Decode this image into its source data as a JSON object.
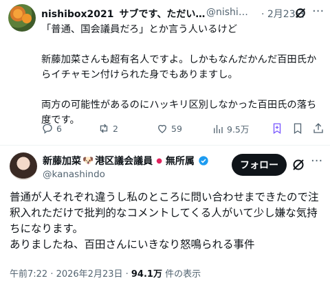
{
  "reply": {
    "display_name": "nishibox2021",
    "subtitle": "サブです、ただい…",
    "handle": "@nishi…",
    "date": "· 2月23日",
    "paragraphs": [
      "「普通、国会議員だろ」とか言う人いるけど",
      "新藤加菜さんも超有名人ですよ。しかもなんだかんだ百田氏からイチャモン付けられた身でもありますし。",
      "両方の可能性があるのにハッキリ区別しなかった百田氏の落ち度です。"
    ],
    "actions": {
      "replies": "6",
      "reposts": "2",
      "likes": "59",
      "views": "9.5万"
    }
  },
  "main_post": {
    "display_name": "新藤加菜",
    "name_suffix": "港区議会議員",
    "party": "無所属",
    "handle": "@kanashindo",
    "follow_label": "フォロー",
    "lines": [
      "普通が人それぞれ違うし私のところに問い合わせまできたので注釈入れただけで批判的なコメントしてくる人がいて少し嫌な気持ちになります。",
      "ありましたね、百田さんにいきなり怒鳴られる事件"
    ],
    "timestamp": "午前7:22 · 2026年2月23日 · ",
    "view_count": "94.1万",
    "view_suffix": " 件の表示"
  },
  "colors": {
    "text": "#0f1419",
    "secondary": "#536471",
    "verified_blue": "#1d9bf0",
    "bookmark_active": "#7856ff"
  }
}
